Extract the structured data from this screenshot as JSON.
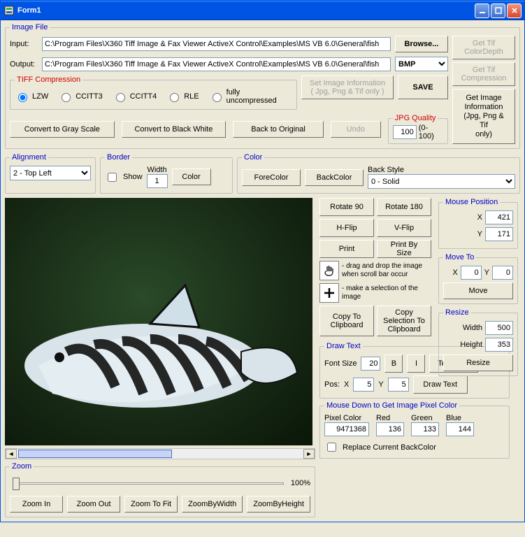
{
  "window": {
    "title": "Form1"
  },
  "imageFile": {
    "legend": "Image File",
    "inputLabel": "Input:",
    "inputPath": "C:\\Program Files\\X360 Tiff Image & Fax Viewer ActiveX Control\\Examples\\MS VB 6.0\\General\\fish",
    "browse": "Browse...",
    "outputLabel": "Output:",
    "outputPath": "C:\\Program Files\\X360 Tiff Image & Fax Viewer ActiveX Control\\Examples\\MS VB 6.0\\General\\fish",
    "format": "BMP",
    "getTifColorDepth": "Get Tif\nColorDepth",
    "getTifCompression": "Get Tif\nCompression",
    "tiffCompression": {
      "legend": "TIFF Compression",
      "options": [
        "LZW",
        "CCITT3",
        "CCITT4",
        "RLE",
        "fully uncompressed"
      ],
      "selected": "LZW"
    },
    "setImageInfo": "Set Image Information\n( Jpg, Png & Tif only )",
    "save": "SAVE",
    "getImageInfo": "Get Image\nInformation\n(Jpg, Png & Tif\nonly)",
    "jpgQuality": {
      "legend": "JPG Quality",
      "value": "100",
      "range": "(0-100)"
    },
    "gray": "Convert to Gray Scale",
    "bw": "Convert to Black White",
    "back": "Back to Original",
    "undo": "Undo"
  },
  "alignment": {
    "legend": "Alignment",
    "value": "2 - Top Left"
  },
  "border": {
    "legend": "Border",
    "show": "Show",
    "widthLabel": "Width",
    "width": "1",
    "color": "Color"
  },
  "color": {
    "legend": "Color",
    "fore": "ForeColor",
    "back": "BackColor",
    "styleLabel": "Back Style",
    "style": "0 - Solid"
  },
  "actions": {
    "rotate90": "Rotate 90",
    "rotate180": "Rotate 180",
    "hflip": "H-Flip",
    "vflip": "V-Flip",
    "print": "Print",
    "printBySize": "Print By Size",
    "dragHint": "- drag and drop the image when scroll bar occur",
    "selectHint": "- make a selection of the image",
    "copyClip": "Copy To\nClipboard",
    "copySelClip": "Copy\nSelection To\nClipboard"
  },
  "mousePos": {
    "legend": "Mouse Position",
    "xLabel": "X",
    "x": "421",
    "yLabel": "Y",
    "y": "171"
  },
  "moveTo": {
    "legend": "Move To",
    "xLabel": "X",
    "x": "0",
    "yLabel": "Y",
    "y": "0",
    "btn": "Move"
  },
  "resize": {
    "legend": "Resize",
    "widthLabel": "Width",
    "width": "500",
    "heightLabel": "Height",
    "height": "353",
    "btn": "Resize"
  },
  "drawText": {
    "legend": "Draw Text",
    "fontSizeLabel": "Font Size",
    "fontSize": "20",
    "b": "B",
    "i": "I",
    "textColor": "TextColor",
    "posLabel": "Pos:",
    "xLabel": "X",
    "x": "5",
    "yLabel": "Y",
    "y": "5",
    "btn": "Draw Text"
  },
  "zoom": {
    "legend": "Zoom",
    "pct": "100%",
    "in": "Zoom In",
    "out": "Zoom Out",
    "fit": "Zoom To Fit",
    "byW": "ZoomByWidth",
    "byH": "ZoomByHeight"
  },
  "pixel": {
    "legend": "Mouse Down to Get Image Pixel Color",
    "pcLabel": "Pixel Color",
    "pc": "9471368",
    "rLabel": "Red",
    "r": "136",
    "gLabel": "Green",
    "g": "133",
    "bLabel": "Blue",
    "b": "144",
    "replace": "Replace Current BackColor"
  }
}
